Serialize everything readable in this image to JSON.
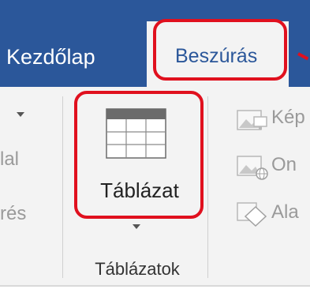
{
  "tabs": [
    {
      "label": "Kezdőlap",
      "active": false
    },
    {
      "label": "Beszúrás",
      "active": true
    }
  ],
  "left_group": {
    "items": [
      "lal",
      "rés"
    ]
  },
  "table_button": {
    "label": "Táblázat",
    "icon": "table-icon"
  },
  "group": {
    "label": "Táblázatok"
  },
  "illustrations": {
    "items": [
      {
        "label": "Kép",
        "icon": "picture-icon"
      },
      {
        "label": "On",
        "icon": "online-picture-icon"
      },
      {
        "label": "Ala",
        "icon": "shapes-icon"
      }
    ]
  },
  "colors": {
    "tab_bar": "#2b579a",
    "ribbon_bg": "#f3f3f3",
    "annotation": "#e0101e",
    "disabled_text": "#9a9a9a"
  }
}
